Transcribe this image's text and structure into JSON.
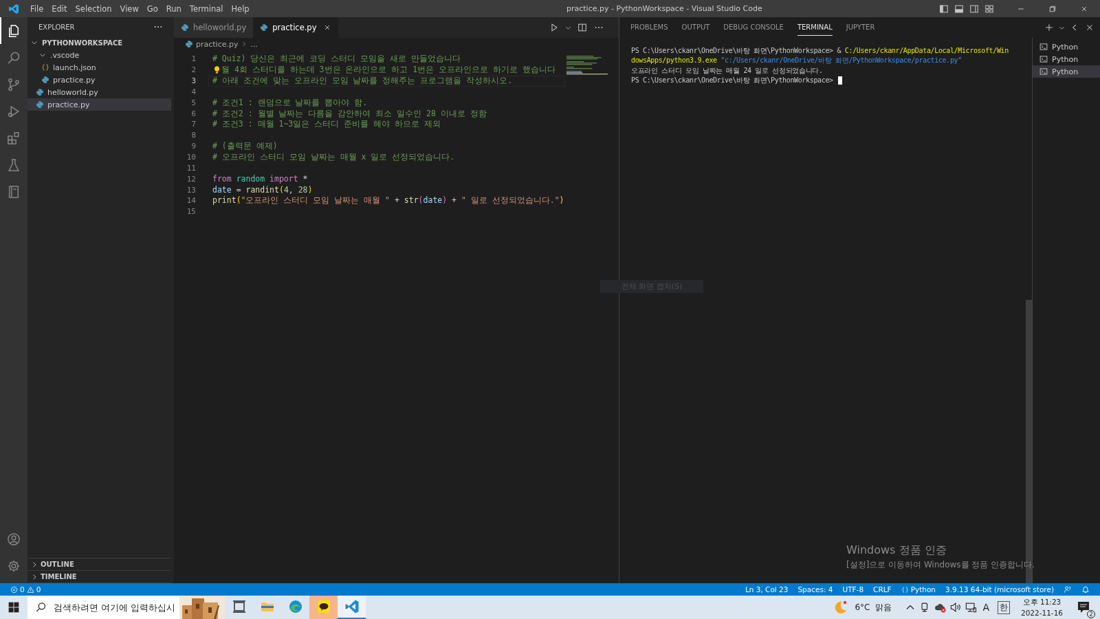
{
  "window": {
    "title": "practice.py - PythonWorkspace - Visual Studio Code"
  },
  "menu": [
    "File",
    "Edit",
    "Selection",
    "View",
    "Go",
    "Run",
    "Terminal",
    "Help"
  ],
  "activity_bar": {
    "top": [
      {
        "kind": "files",
        "selected": true
      },
      {
        "kind": "search",
        "selected": false
      },
      {
        "kind": "scm",
        "selected": false
      },
      {
        "kind": "run",
        "selected": false
      },
      {
        "kind": "extensions",
        "selected": false
      },
      {
        "kind": "flask",
        "selected": false
      },
      {
        "kind": "notebook",
        "selected": false
      }
    ],
    "bottom": [
      {
        "kind": "account",
        "selected": false
      },
      {
        "kind": "gear",
        "selected": false
      }
    ]
  },
  "sidebar": {
    "title": "EXPLORER",
    "tree": [
      {
        "label": "PYTHONWORKSPACE",
        "kind": "root",
        "expanded": true,
        "selected": false,
        "children": [
          {
            "label": ".vscode",
            "kind": "folder",
            "expanded": true,
            "selected": false,
            "children": [
              {
                "label": "launch.json",
                "kind": "json",
                "selected": false
              },
              {
                "label": "practice.py",
                "kind": "python",
                "selected": false
              }
            ]
          },
          {
            "label": "helloworld.py",
            "kind": "python",
            "selected": false
          },
          {
            "label": "practice.py",
            "kind": "python",
            "selected": true
          }
        ]
      }
    ],
    "sections": [
      {
        "label": "OUTLINE",
        "expanded": false
      },
      {
        "label": "TIMELINE",
        "expanded": false
      }
    ]
  },
  "editor": {
    "tabs": [
      {
        "label": "helloworld.py",
        "selected": false
      },
      {
        "label": "practice.py",
        "selected": true
      }
    ],
    "breadcrumb": [
      "practice.py",
      "..."
    ],
    "lines": [
      {
        "number": "1",
        "current": false,
        "lightbulb": false,
        "tokens": [
          {
            "kind": "comment",
            "text": "# Quiz) 당신은 최근에 코딩 스터디 모임을 새로 만들었습니다"
          }
        ]
      },
      {
        "number": "2",
        "current": false,
        "lightbulb": true,
        "tokens": [
          {
            "kind": "comment",
            "text": "월 4회 스터디를 하는데 3번은 온라인으로 하고 1번은 오프라인으로 하기로 했습니다"
          }
        ]
      },
      {
        "number": "3",
        "current": true,
        "lightbulb": false,
        "tokens": [
          {
            "kind": "comment",
            "text": "# 아래 조건에 맞는 오프라인 모임 날짜를 정해주는 프로그램을 작성하시오."
          }
        ]
      },
      {
        "number": "4",
        "current": false,
        "lightbulb": false
      },
      {
        "number": "5",
        "current": false,
        "lightbulb": false,
        "tokens": [
          {
            "kind": "comment",
            "text": "# 조건1 : 랜덤으로 날짜를 뽑아야 함."
          }
        ]
      },
      {
        "number": "6",
        "current": false,
        "lightbulb": false,
        "tokens": [
          {
            "kind": "comment",
            "text": "# 조건2 : 월별 날짜는 다름을 감안하여 최소 일수인 28 이내로 정함"
          }
        ]
      },
      {
        "number": "7",
        "current": false,
        "lightbulb": false,
        "tokens": [
          {
            "kind": "comment",
            "text": "# 조건3 : 매월 1~3일은 스터디 준비를 해야 하므로 제외"
          }
        ]
      },
      {
        "number": "8",
        "current": false,
        "lightbulb": false
      },
      {
        "number": "9",
        "current": false,
        "lightbulb": false,
        "tokens": [
          {
            "kind": "comment",
            "text": "# (출력문 예제)"
          }
        ]
      },
      {
        "number": "10",
        "current": false,
        "lightbulb": false,
        "tokens": [
          {
            "kind": "comment",
            "text": "# 오프라인 스터디 모임 날짜는 매월 x 일로 선정되었습니다."
          }
        ]
      },
      {
        "number": "11",
        "current": false,
        "lightbulb": false
      },
      {
        "number": "12",
        "current": false,
        "lightbulb": false,
        "tokens": [
          {
            "kind": "keyword",
            "text": "from"
          },
          {
            "kind": "module",
            "text": " random"
          },
          {
            "kind": "keyword",
            "text": " import"
          },
          {
            "kind": "plain",
            "text": " *"
          }
        ]
      },
      {
        "number": "13",
        "current": false,
        "lightbulb": false,
        "tokens": [
          {
            "kind": "variable",
            "text": "date"
          },
          {
            "kind": "plain",
            "text": " = "
          },
          {
            "kind": "function",
            "text": "randint"
          },
          {
            "kind": "bracket1",
            "text": "("
          },
          {
            "kind": "number",
            "text": "4"
          },
          {
            "kind": "plain",
            "text": ", "
          },
          {
            "kind": "number",
            "text": "28"
          },
          {
            "kind": "bracket1",
            "text": ")"
          }
        ]
      },
      {
        "number": "14",
        "current": false,
        "lightbulb": false,
        "tokens": [
          {
            "kind": "function",
            "text": "print"
          },
          {
            "kind": "bracket1",
            "text": "("
          },
          {
            "kind": "string",
            "text": "\"오프라인 스터디 모임 날짜는 매월 \""
          },
          {
            "kind": "plain",
            "text": " + "
          },
          {
            "kind": "function",
            "text": "str"
          },
          {
            "kind": "bracket2",
            "text": "("
          },
          {
            "kind": "variable",
            "text": "date"
          },
          {
            "kind": "bracket2",
            "text": ")"
          },
          {
            "kind": "plain",
            "text": " + "
          },
          {
            "kind": "string",
            "text": "\" 일로 선정되었습니다.\""
          },
          {
            "kind": "bracket1",
            "text": ")"
          }
        ]
      },
      {
        "number": "15",
        "current": false,
        "lightbulb": false
      }
    ]
  },
  "panel": {
    "tabs": [
      {
        "label": "PROBLEMS",
        "selected": false
      },
      {
        "label": "OUTPUT",
        "selected": false
      },
      {
        "label": "DEBUG CONSOLE",
        "selected": false
      },
      {
        "label": "TERMINAL",
        "selected": true
      },
      {
        "label": "JUPYTER",
        "selected": false
      }
    ],
    "terminal_lines": [
      {
        "cursor": false,
        "tokens": [
          {
            "kind": "plain",
            "text": "PS C:\\Users\\ckanr\\OneDrive\\바탕 화면\\PythonWorkspace> & "
          },
          {
            "kind": "path",
            "text": "C:/Users/ckanr/AppData/Local/Microsoft/Win"
          }
        ]
      },
      {
        "cursor": false,
        "tokens": [
          {
            "kind": "path",
            "text": "dowsApps/python3.9.exe"
          },
          {
            "kind": "string",
            "text": " \"c:/Users/ckanr/OneDrive/바탕 화면/PythonWorkspace/practice.py\""
          }
        ]
      },
      {
        "cursor": false,
        "tokens": [
          {
            "kind": "plain",
            "text": "오프라인 스터디 모임 날짜는 매월 24 일로 선정되었습니다."
          }
        ]
      },
      {
        "cursor": true,
        "tokens": [
          {
            "kind": "plain",
            "text": "PS C:\\Users\\ckanr\\OneDrive\\바탕 화면\\PythonWorkspace> "
          }
        ]
      }
    ],
    "sessions": [
      {
        "label": "Python",
        "selected": false
      },
      {
        "label": "Python",
        "selected": false
      },
      {
        "label": "Python",
        "selected": true
      }
    ]
  },
  "tooltip": {
    "text": "전체 화면 캡처(S)"
  },
  "activation_notice": {
    "title": "Windows 정품 인증",
    "text": "[설정]으로 이동하여 Windows를 정품 인증합니다."
  },
  "status_bar": {
    "errors": "0",
    "warnings": "0",
    "items": [
      {
        "kind": "text",
        "label": "Ln 3, Col 23"
      },
      {
        "kind": "text",
        "label": "Spaces: 4"
      },
      {
        "kind": "text",
        "label": "UTF-8"
      },
      {
        "kind": "text",
        "label": "CRLF"
      },
      {
        "kind": "language",
        "label": "Python"
      },
      {
        "kind": "text",
        "label": "3.9.13 64-bit (microsoft store)"
      }
    ]
  },
  "taskbar": {
    "search": {
      "placeholder": "검색하려면 여기에 입력하십시"
    },
    "apps": [
      {
        "kind": "taskview",
        "active": false,
        "flashing": false
      },
      {
        "kind": "folder",
        "active": false,
        "flashing": false
      },
      {
        "kind": "edge",
        "active": false,
        "flashing": false
      },
      {
        "kind": "kakao",
        "active": false,
        "flashing": true
      },
      {
        "kind": "vscode",
        "active": true,
        "flashing": false
      }
    ],
    "weather": {
      "temperature": "6°C",
      "condition": "맑음"
    },
    "ime": [
      "A",
      "한"
    ],
    "clock": {
      "time": "오후 11:23",
      "date": "2022-11-16"
    },
    "notifications": "2"
  }
}
